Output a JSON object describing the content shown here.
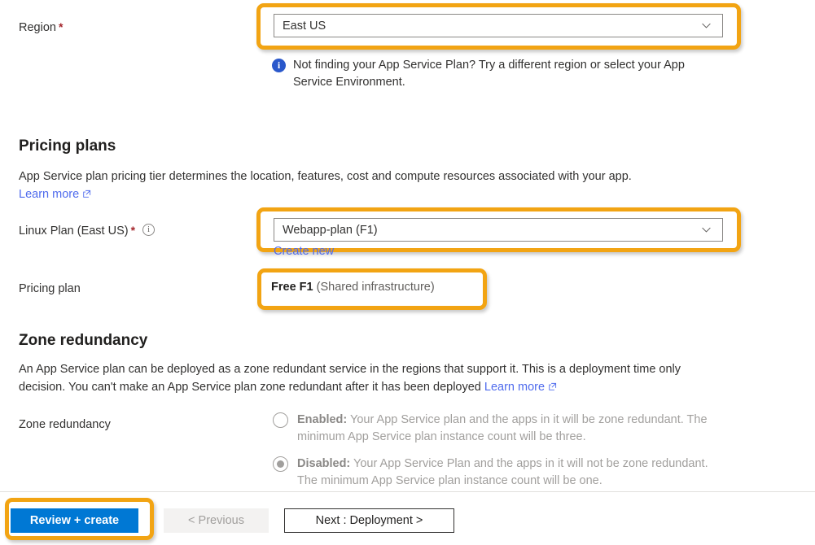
{
  "region": {
    "label": "Region",
    "required_marker": "*",
    "selected": "East US",
    "info_message": "Not finding your App Service Plan? Try a different region or select your App Service Environment.",
    "info_icon": "info-filled-icon",
    "chevron_icon": "chevron-down-icon"
  },
  "pricing_plans": {
    "heading": "Pricing plans",
    "description": "App Service plan pricing tier determines the location, features, cost and compute resources associated with your app.",
    "learn_more": "Learn more",
    "external_link_icon": "external-link-icon",
    "plan_label": "Linux Plan (East US)",
    "plan_required_marker": "*",
    "plan_info_icon": "info-outline-icon",
    "plan_selected": "Webapp-plan (F1)",
    "create_new": "Create new",
    "pricing_plan_label": "Pricing plan",
    "pricing_plan_value_bold": "Free F1",
    "pricing_plan_value_rest": "(Shared infrastructure)",
    "chevron_icon": "chevron-down-icon"
  },
  "zone_redundancy": {
    "heading": "Zone redundancy",
    "description": "An App Service plan can be deployed as a zone redundant service in the regions that support it. This is a deployment time only decision. You can't make an App Service plan zone redundant after it has been deployed",
    "learn_more": "Learn more",
    "external_link_icon": "external-link-icon",
    "field_label": "Zone redundancy",
    "options": [
      {
        "id": "enabled",
        "bold": "Enabled:",
        "text": " Your App Service plan and the apps in it will be zone redundant. The minimum App Service plan instance count will be three.",
        "checked": false
      },
      {
        "id": "disabled",
        "bold": "Disabled:",
        "text": " Your App Service Plan and the apps in it will not be zone redundant. The minimum App Service plan instance count will be one.",
        "checked": true
      }
    ]
  },
  "footer": {
    "review_create": "Review + create",
    "previous": "< Previous",
    "next": "Next : Deployment >"
  },
  "highlights": {
    "color": "#f2a413",
    "count": 4,
    "targets": [
      "region-dropdown",
      "linux-plan-dropdown",
      "pricing-plan-value",
      "review-create-button"
    ]
  }
}
